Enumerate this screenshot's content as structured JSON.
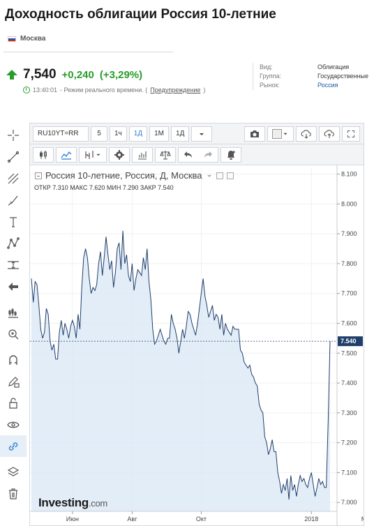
{
  "page": {
    "title": "Доходность облигации Россия 10-летние",
    "exchange": "Москва"
  },
  "quote": {
    "price": "7,540",
    "change": "+0,240",
    "change_pct": "(+3,29%)",
    "time": "13:40:01",
    "realtime_text": "- Режим реального времени. (",
    "disclaimer_link": "Предупреждение",
    "realtime_close": ")"
  },
  "meta": [
    {
      "key": "Вид:",
      "value": "Облигация"
    },
    {
      "key": "Группа:",
      "value": "Государственные"
    },
    {
      "key": "Рынок:",
      "value": "Россия"
    }
  ],
  "toolbar": {
    "symbol": "RU10YT=RR",
    "intervals": [
      "5",
      "1ч",
      "1Д",
      "1М",
      "1Д"
    ],
    "active_interval": "1Д"
  },
  "legend": {
    "name": "Россия 10-летние, Россия, Д, Москва",
    "ohlc": "ОТКР 7.310  МАКС 7.620  МИН 7.290  ЗАКР 7.540"
  },
  "logo": {
    "main": "Investing",
    "suffix": ".com"
  },
  "left_tools": [
    "crosshair-icon",
    "trend-line-icon",
    "pitchfork-icon",
    "brush-icon",
    "text-icon",
    "pattern-icon",
    "measure-icon",
    "back-arrow-icon",
    "zoom-candles-icon",
    "zoom-in-icon",
    "magnet-icon",
    "pencil-lock-icon",
    "lock-icon",
    "eye-icon",
    "link-icon",
    "layers-icon",
    "trash-icon"
  ],
  "colors": {
    "line": "#1f3e6b",
    "fill": "#dce9f6",
    "last_price_bg": "#1f3e6b",
    "up": "#2a9d2a"
  },
  "chart_data": {
    "type": "area",
    "title": "Россия 10-летние, Россия, Д, Москва",
    "y_ticks": [
      "8.100",
      "8.000",
      "7.900",
      "7.800",
      "7.700",
      "7.600",
      "7.500",
      "7.400",
      "7.300",
      "7.200",
      "7.100",
      "7.000"
    ],
    "x_ticks": [
      "Июн",
      "Авг",
      "Окт",
      "2018",
      "Мар"
    ],
    "ylim": [
      6.97,
      8.12
    ],
    "last_value": "7.540",
    "series": [
      {
        "values": [
          7.75,
          7.67,
          7.74,
          7.73,
          7.66,
          7.58,
          7.55,
          7.57,
          7.65,
          7.63,
          7.54,
          7.51,
          7.53,
          7.48,
          7.48,
          7.57,
          7.61,
          7.56,
          7.6,
          7.58,
          7.55,
          7.59,
          7.61,
          7.59,
          7.55,
          7.63,
          7.58,
          7.72,
          7.82,
          7.85,
          7.82,
          7.75,
          7.7,
          7.72,
          7.71,
          7.73,
          7.8,
          7.84,
          7.76,
          7.82,
          7.89,
          7.83,
          7.78,
          7.81,
          7.72,
          7.77,
          7.85,
          7.87,
          7.78,
          7.91,
          7.8,
          7.83,
          7.76,
          7.74,
          7.8,
          7.71,
          7.75,
          7.78,
          7.77,
          7.76,
          7.82,
          7.78,
          7.85,
          7.74,
          7.68,
          7.58,
          7.53,
          7.54,
          7.56,
          7.58,
          7.56,
          7.54,
          7.53,
          7.55,
          7.55,
          7.63,
          7.6,
          7.58,
          7.55,
          7.5,
          7.54,
          7.58,
          7.55,
          7.59,
          7.64,
          7.63,
          7.6,
          7.58,
          7.56,
          7.6,
          7.65,
          7.7,
          7.75,
          7.69,
          7.66,
          7.62,
          7.64,
          7.66,
          7.61,
          7.63,
          7.62,
          7.58,
          7.63,
          7.56,
          7.6,
          7.58,
          7.57,
          7.56,
          7.59,
          7.58,
          7.58,
          7.58,
          7.51,
          7.5,
          7.47,
          7.46,
          7.45,
          7.46,
          7.43,
          7.42,
          7.4,
          7.39,
          7.33,
          7.31,
          7.3,
          7.22,
          7.2,
          7.16,
          7.18,
          7.21,
          7.17,
          7.17,
          7.1,
          7.07,
          7.03,
          7.06,
          7.04,
          7.08,
          7.01,
          7.09,
          7.04,
          7.06,
          7.02,
          7.06,
          7.09,
          7.07,
          7.08,
          7.06,
          7.05,
          7.08,
          7.1,
          7.06,
          7.02,
          7.05,
          7.08,
          7.06,
          7.07,
          7.05,
          7.05,
          7.27,
          7.54
        ]
      }
    ]
  }
}
